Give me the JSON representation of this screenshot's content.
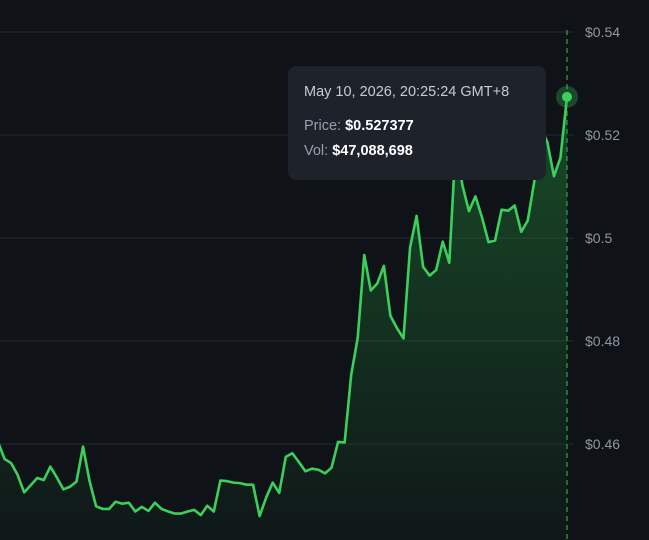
{
  "colors": {
    "background": "#0f1217",
    "line": "#3ccf5c",
    "fill": "#1f7a35",
    "grid": "#232932",
    "crosshair": "#2ea84a",
    "tick_text": "#8f97a3",
    "tooltip_bg": "#1d222b"
  },
  "tooltip": {
    "date": "May 10, 2026, 20:25:24 GMT+8",
    "price_label": "Price:",
    "price_value": "$0.527377",
    "vol_label": "Vol:",
    "vol_value": "$47,088,698"
  },
  "chart_data": {
    "type": "area",
    "grid": true,
    "y_axis_position": "right",
    "ylim": [
      0.4407,
      0.5437
    ],
    "yticks": [
      {
        "value": 0.54,
        "label": "$0.54"
      },
      {
        "value": 0.52,
        "label": "$0.52"
      },
      {
        "value": 0.5,
        "label": "$0.5"
      },
      {
        "value": 0.48,
        "label": "$0.48"
      },
      {
        "value": 0.46,
        "label": "$0.46"
      }
    ],
    "series": [
      {
        "values": [
          0.4604,
          0.4571,
          0.4563,
          0.454,
          0.4506,
          0.452,
          0.4534,
          0.453,
          0.4556,
          0.4535,
          0.4512,
          0.4517,
          0.4527,
          0.4595,
          0.4528,
          0.4479,
          0.4474,
          0.4474,
          0.4488,
          0.4484,
          0.4486,
          0.4469,
          0.4478,
          0.447,
          0.4486,
          0.4474,
          0.4469,
          0.4465,
          0.4465,
          0.4469,
          0.4472,
          0.4462,
          0.448,
          0.4469,
          0.4529,
          0.4528,
          0.4525,
          0.4524,
          0.4521,
          0.4521,
          0.446,
          0.4496,
          0.4525,
          0.4505,
          0.4575,
          0.4582,
          0.4565,
          0.4547,
          0.4552,
          0.455,
          0.4543,
          0.4554,
          0.4604,
          0.4603,
          0.4734,
          0.4806,
          0.4967,
          0.4898,
          0.4912,
          0.4946,
          0.4849,
          0.4825,
          0.4805,
          0.4981,
          0.5043,
          0.4944,
          0.4927,
          0.4938,
          0.4993,
          0.4952,
          0.5187,
          0.5103,
          0.5052,
          0.5081,
          0.504,
          0.4992,
          0.4995,
          0.5055,
          0.5053,
          0.5063,
          0.5012,
          0.5034,
          0.511,
          0.5214,
          0.5186,
          0.512,
          0.5156,
          0.5274
        ]
      }
    ],
    "highlight_index": 87
  }
}
